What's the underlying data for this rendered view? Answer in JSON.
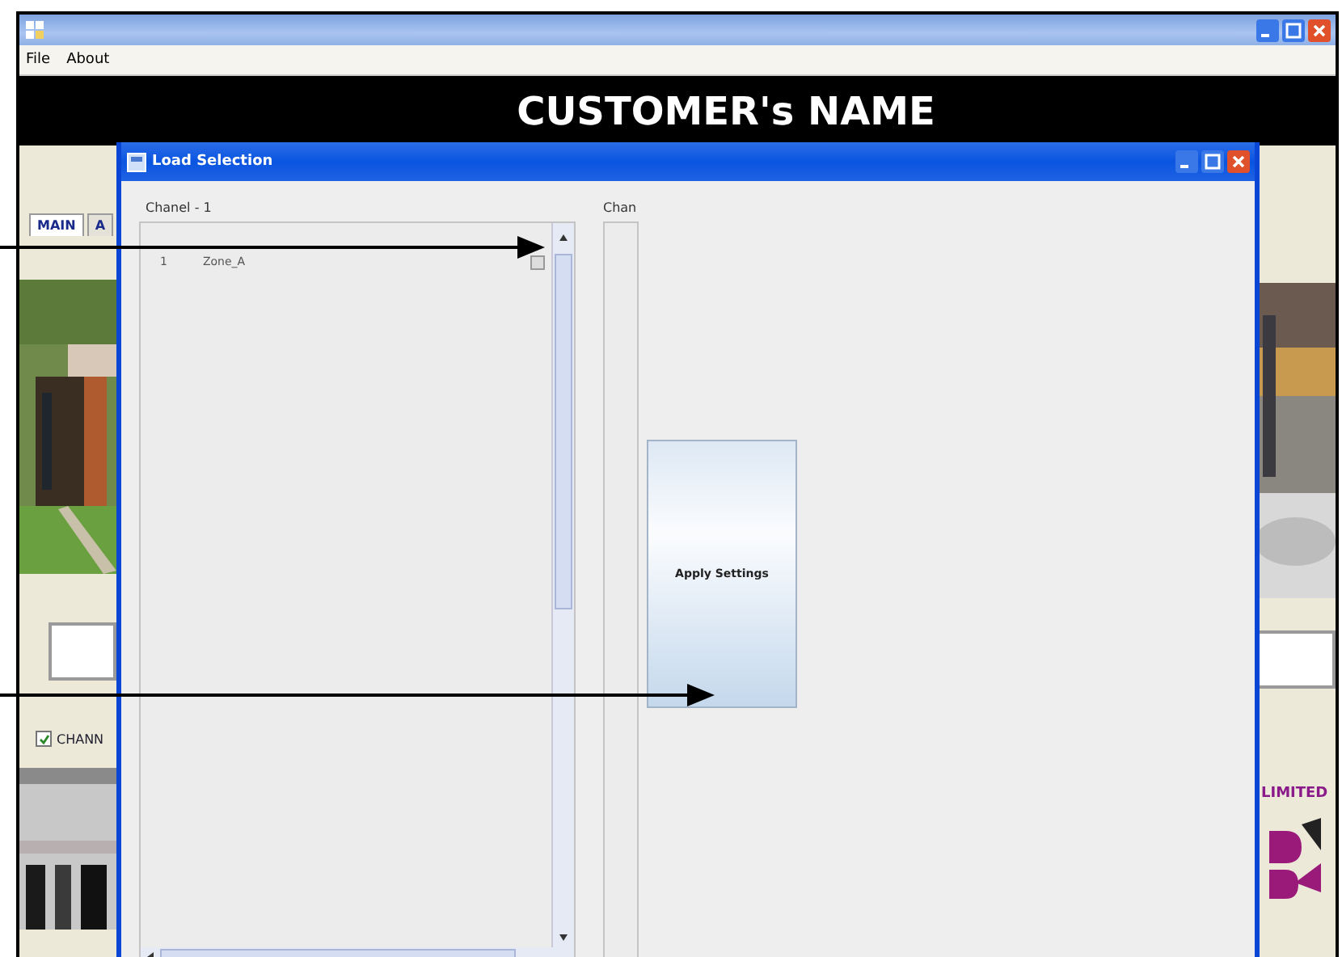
{
  "app": {
    "menu": [
      "File",
      "About"
    ],
    "header": "CUSTOMER's NAME",
    "tabs": [
      {
        "label": "MAIN",
        "selected": true
      },
      {
        "label": "A",
        "selected": false
      }
    ],
    "channel_checkbox": {
      "label": "CHANN",
      "checked": true
    },
    "company_text": "LIMITED"
  },
  "dialog": {
    "title": "Load Selection",
    "left_panel": {
      "title": "Chanel - 1",
      "rows": [
        {
          "cells": [
            "1",
            "Zone_A"
          ]
        }
      ]
    },
    "right_panel": {
      "title": "Chan"
    },
    "apply_button": "Apply Settings"
  }
}
